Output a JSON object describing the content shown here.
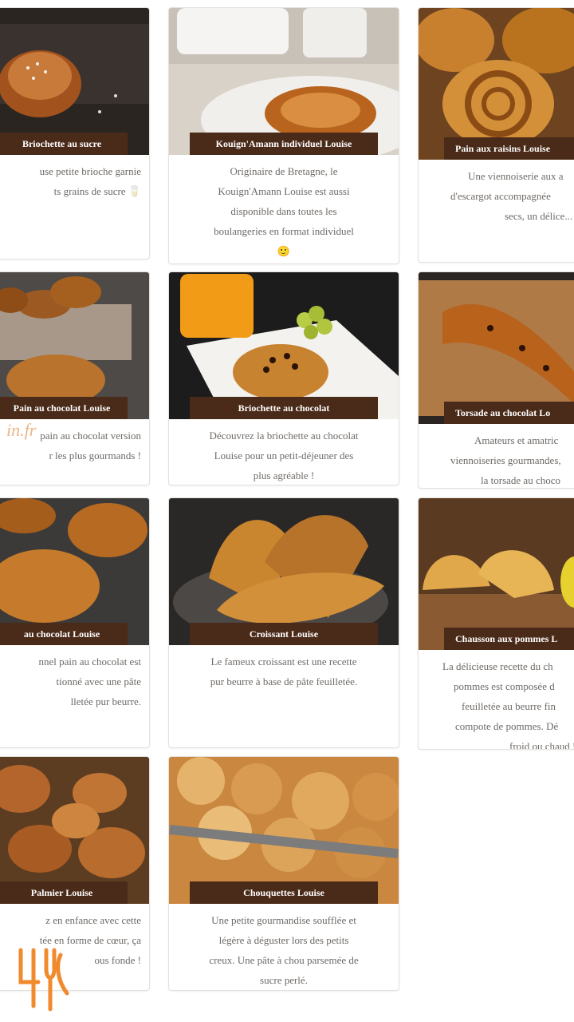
{
  "products": [
    {
      "title": "Briochette au sucre",
      "desc": [
        "use petite brioche garnie",
        "ts grains de sucre 🥛"
      ]
    },
    {
      "title": "Kouign'Amann individuel Louise",
      "desc": [
        "Originaire de Bretagne, le",
        "Kouign'Amann Louise est aussi",
        "disponible dans toutes les",
        "boulangeries en format individuel",
        "🙂"
      ]
    },
    {
      "title": "Pain aux raisins Louise",
      "desc": [
        "Une viennoiserie aux a",
        "d'escargot accompagnée",
        "secs, un délice..."
      ]
    },
    {
      "title": "Pain au chocolat Louise",
      "desc": [
        "pain au chocolat version",
        "r les plus gourmands !"
      ]
    },
    {
      "title": "Briochette au chocolat",
      "desc": [
        "Découvrez la briochette au chocolat",
        "Louise pour un petit-déjeuner des",
        "plus agréable !"
      ]
    },
    {
      "title": "Torsade au chocolat Lo",
      "desc": [
        "Amateurs et amatric",
        "viennoiseries gourmandes,",
        "la torsade au choco"
      ]
    },
    {
      "title": "au chocolat Louise",
      "desc": [
        "nnel pain au chocolat est",
        "tionné avec une pâte",
        "lletée pur beurre."
      ]
    },
    {
      "title": "Croissant Louise",
      "desc": [
        "Le fameux croissant est une recette",
        "pur beurre à base de pâte feuilletée."
      ]
    },
    {
      "title": "Chausson aux pommes L",
      "desc": [
        "La délicieuse recette du ch",
        "pommes est composée d",
        "feuilletée au beurre fin",
        "compote de pommes. Dé",
        "froid ou chaud !"
      ]
    },
    {
      "title": "Palmier Louise",
      "desc": [
        "z en enfance avec cette",
        "tée en forme de cœur, ça",
        "ous  fonde !"
      ]
    },
    {
      "title": "Chouquettes Louise",
      "desc": [
        "Une petite gourmandise soufflée et",
        "légère à déguster lors des petits",
        "creux. Une pâte à chou parsemée de",
        "sucre perlé."
      ]
    }
  ],
  "watermark": "in.fr",
  "logo_icon": "fork-logo-icon",
  "colors": {
    "ribbon": "#4a2a18",
    "text": "#6e6a66",
    "accent": "#e8a36a"
  }
}
